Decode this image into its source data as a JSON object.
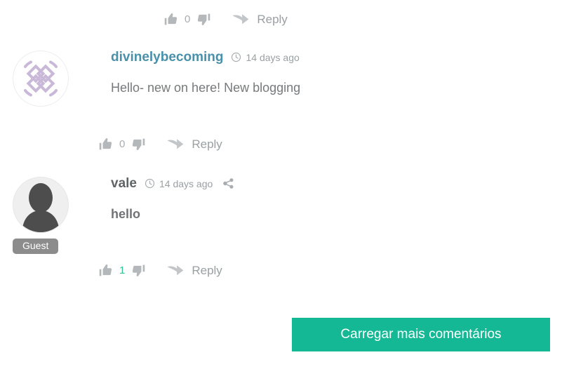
{
  "thread": {
    "top_partial_actions": {
      "thumb_up_icon": "thumb-up-icon",
      "vote_count": "0",
      "thumb_down_icon": "thumb-down-icon",
      "reply_arrow_icon": "reply-arrow-icon",
      "reply_label": "Reply"
    },
    "comments": [
      {
        "author": "divinelybecoming",
        "author_style": "link",
        "clock_icon": "clock-icon",
        "timestamp": "14 days ago",
        "has_share": false,
        "share_icon": "share-icon",
        "text": "Hello- new on here! New blogging",
        "text_bold": false,
        "avatar_type": "pattern",
        "avatar_icon": "diamond-pattern-avatar-icon",
        "badge": "",
        "actions": {
          "thumb_up_icon": "thumb-up-icon",
          "vote_count": "0",
          "vote_positive": false,
          "thumb_down_icon": "thumb-down-icon",
          "reply_arrow_icon": "reply-arrow-icon",
          "reply_label": "Reply"
        }
      },
      {
        "author": "vale",
        "author_style": "plain",
        "clock_icon": "clock-icon",
        "timestamp": "14 days ago",
        "has_share": true,
        "share_icon": "share-icon",
        "text": "hello",
        "text_bold": true,
        "avatar_type": "guest",
        "avatar_icon": "person-silhouette-avatar-icon",
        "badge": "Guest",
        "actions": {
          "thumb_up_icon": "thumb-up-icon",
          "vote_count": "1",
          "vote_positive": true,
          "thumb_down_icon": "thumb-down-icon",
          "reply_arrow_icon": "reply-arrow-icon",
          "reply_label": "Reply"
        }
      }
    ],
    "load_more_button": {
      "label": "Carregar mais comentários"
    }
  },
  "colors": {
    "accent_button": "#14b894",
    "author_link": "#4a90ab",
    "author_plain": "#5f6467",
    "upvote_green": "#2ec68f",
    "muted_text": "#9aa0a3",
    "avatar_pattern": "#c9b8d8",
    "guest_badge": "#8c8c8c"
  }
}
